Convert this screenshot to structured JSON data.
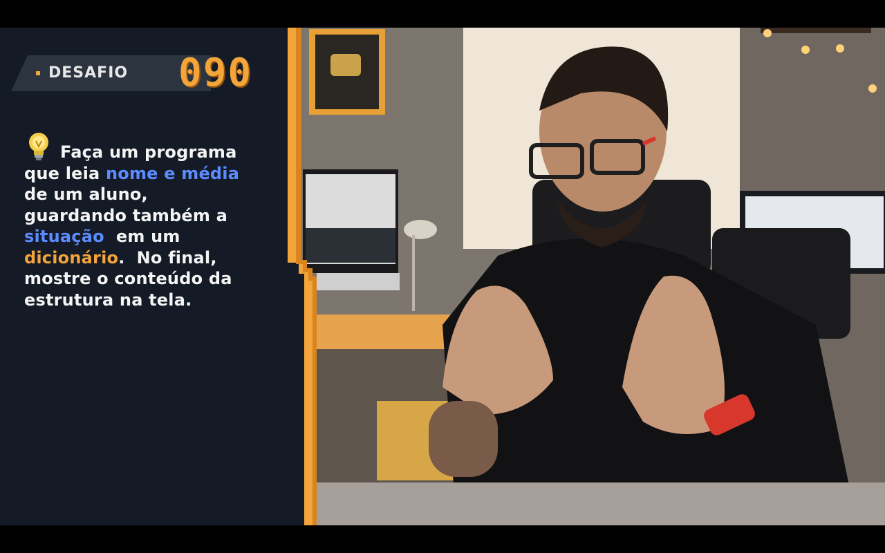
{
  "overlay": {
    "challenge_label": "DESAFIO",
    "challenge_number": "090",
    "instructions": {
      "l1_text": "Faça um programa",
      "l2_prefix": "que leia ",
      "l2_highlight": "nome e média",
      "l3_text": "de um aluno,",
      "l4_text": "guardando  também a",
      "l5_highlight": "situação",
      "l5_suffix": "  em um",
      "l6_highlight": "dicionário",
      "l6_suffix": ".  No final,",
      "l7_text": "mostre o conteúdo da",
      "l8_text": "estrutura na tela."
    },
    "colors": {
      "panel_bg": "#141b26",
      "accent_orange": "#f3a43a",
      "highlight_blue": "#5b8cff",
      "text": "#f4f4f4"
    },
    "icons": [
      "lightbulb-icon"
    ]
  }
}
